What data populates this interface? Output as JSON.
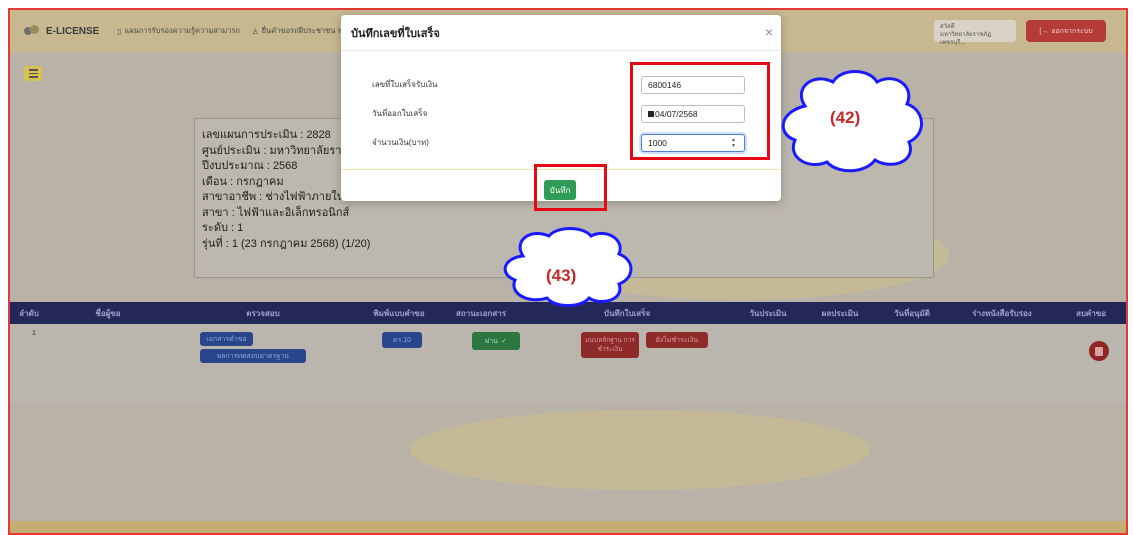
{
  "app": {
    "brand": "E-LICENSE",
    "nav": [
      "แผนการรับรองความรู้ความสามารถ",
      "ยื่นคำขอรถฝีประชาชน ฟอ"
    ],
    "user_line1": "สวัสดี",
    "user_line2": "มหาวิทยาลัยราชภัฏเพชรบุรี...",
    "logout_label": "ออกจากระบบ"
  },
  "info": {
    "lines": [
      "เลขแผนการประเมิน : 2828",
      "ศูนย์ประเมิน : มหาวิทยาลัยราช",
      "ปีงบประมาณ : 2568",
      "เดือน : กรกฎาคม",
      "สาขาอาชีพ : ช่างไฟฟ้าภายในอ",
      "สาขา : ไฟฟ้าและอิเล็กทรอนิกส์",
      "ระดับ : 1",
      "รุ่นที่ : 1 (23 กรกฎาคม 2568) (1/20)"
    ]
  },
  "table": {
    "headers": [
      "ลำดับ",
      "ชื่อผู้ขอ",
      "ตรวจสอบ",
      "พิมพ์แบบคำขอ",
      "สถานะเอกสาร",
      "บันทึกใบเสร็จ",
      "วันประเมิน",
      "ผลประเมิน",
      "วันที่อนุมัติ",
      "ร่างหนังสือรับรอง",
      "ลบคำขอ"
    ],
    "row": {
      "index": "1",
      "check_doc": "เอกสารคำขอ",
      "check_exam": "ผลการทดสอบมาตรฐาน",
      "print_form": "คร.10",
      "doc_status": "ผ่าน",
      "upload_receipt": "แนบหลักฐาน การชำระเงิน",
      "payment_status": "ยังไม่ชำระเงิน"
    }
  },
  "modal": {
    "title": "บันทึกเลขที่ใบเสร็จ",
    "close": "×",
    "fields": [
      {
        "label": "เลขที่ใบเสร็จรับเงิน",
        "value": "6800146"
      },
      {
        "label": "วันที่ออกใบเสร็จ",
        "value": "04/07/2568"
      },
      {
        "label": "จำนวนเงิน(บาท)",
        "value": "1000"
      }
    ],
    "save_label": "บันทึก"
  },
  "callouts": {
    "c42": "(42)",
    "c43": "(43)"
  },
  "colors": {
    "highlight": "#e50914",
    "callout_text": "#c62828",
    "cloud_stroke": "#1a1aff",
    "save_green": "#2e9b56",
    "table_header": "#24275a"
  }
}
